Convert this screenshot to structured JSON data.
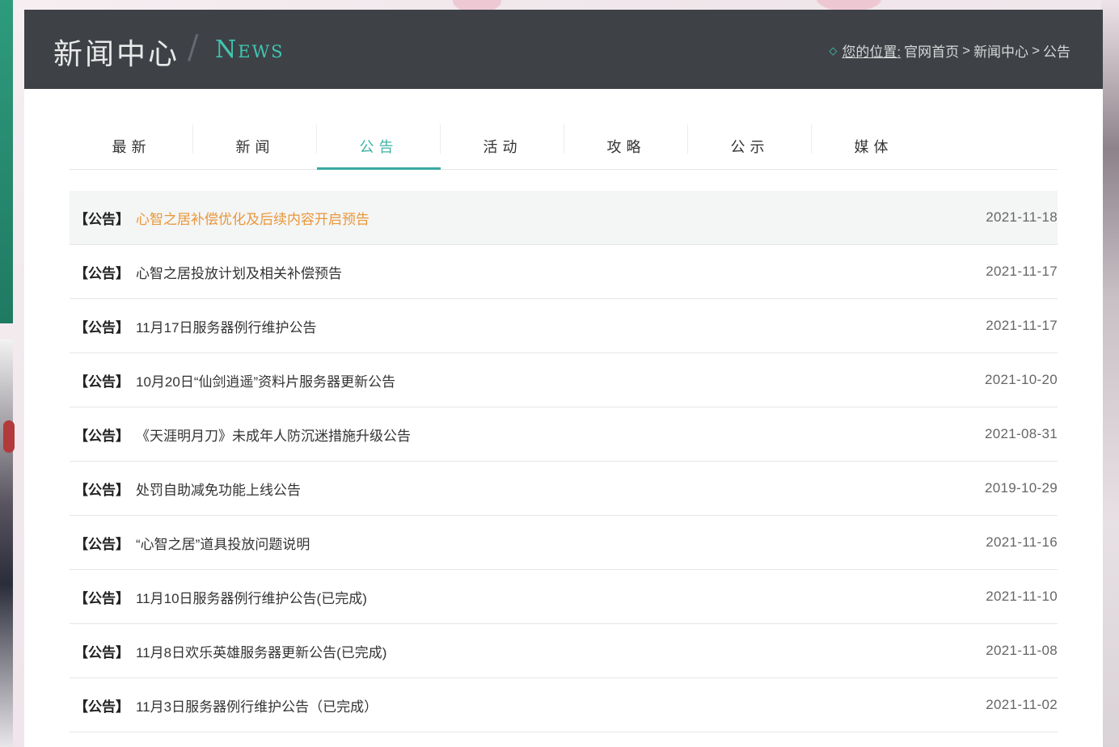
{
  "header": {
    "title": "新闻中心",
    "title_en": "News",
    "breadcrumb": {
      "prefix": "您的位置:",
      "items": [
        "官网首页",
        "新闻中心",
        "公告"
      ],
      "separator": ">"
    }
  },
  "tabs": [
    {
      "label": "最新"
    },
    {
      "label": "新闻"
    },
    {
      "label": "公告",
      "active": true
    },
    {
      "label": "活动"
    },
    {
      "label": "攻略"
    },
    {
      "label": "公示"
    },
    {
      "label": "媒体"
    }
  ],
  "news": [
    {
      "tag": "【公告】",
      "title": "心智之居补偿优化及后续内容开启预告",
      "date": "2021-11-18",
      "highlight": true
    },
    {
      "tag": "【公告】",
      "title": "心智之居投放计划及相关补偿预告",
      "date": "2021-11-17"
    },
    {
      "tag": "【公告】",
      "title": "11月17日服务器例行维护公告",
      "date": "2021-11-17"
    },
    {
      "tag": "【公告】",
      "title": "10月20日“仙剑逍遥”资料片服务器更新公告",
      "date": "2021-10-20"
    },
    {
      "tag": "【公告】",
      "title": "《天涯明月刀》未成年人防沉迷措施升级公告",
      "date": "2021-08-31"
    },
    {
      "tag": "【公告】",
      "title": "处罚自助减免功能上线公告",
      "date": "2019-10-29"
    },
    {
      "tag": "【公告】",
      "title": "“心智之居”道具投放问题说明",
      "date": "2021-11-16"
    },
    {
      "tag": "【公告】",
      "title": "11月10日服务器例行维护公告(已完成)",
      "date": "2021-11-10"
    },
    {
      "tag": "【公告】",
      "title": "11月8日欢乐英雄服务器更新公告(已完成)",
      "date": "2021-11-08"
    },
    {
      "tag": "【公告】",
      "title": "11月3日服务器例行维护公告（已完成）",
      "date": "2021-11-02"
    }
  ],
  "colors": {
    "header_bg": "#3e4247",
    "accent": "#3fb3a6",
    "highlight_title": "#e9973a"
  }
}
